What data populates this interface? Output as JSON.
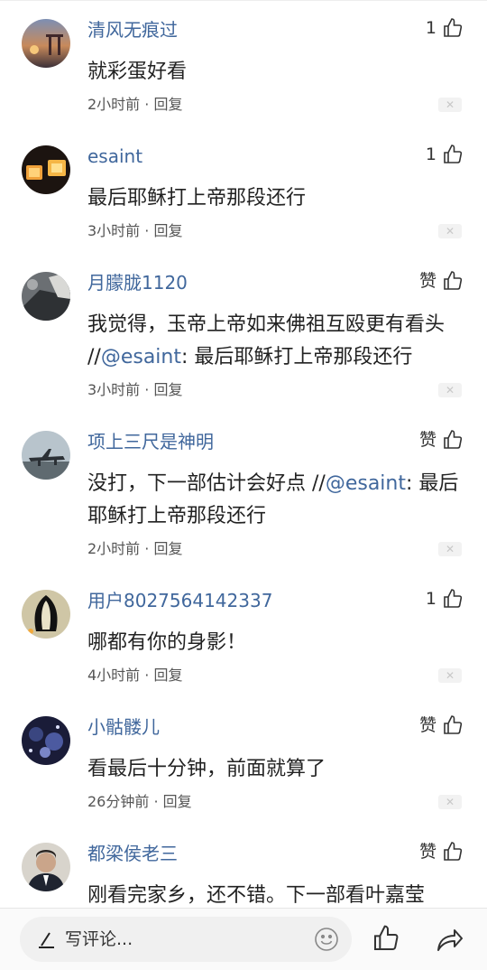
{
  "comments": [
    {
      "user": "清风无痕过",
      "likes": "1",
      "text": "就彩蛋好看",
      "mention": "",
      "after": "",
      "time": "2小时前",
      "reply": "回复",
      "avatar": "sunset-avatar"
    },
    {
      "user": "esaint",
      "likes": "1",
      "text": "最后耶稣打上帝那段还行",
      "mention": "",
      "after": "",
      "time": "3小时前",
      "reply": "回复",
      "avatar": "lantern-avatar"
    },
    {
      "user": "月朦胧1120",
      "likes": "赞",
      "text": "我觉得，玉帝上帝如来佛祖互殴更有看头 //",
      "mention": "@esaint",
      "after": ": 最后耶稣打上帝那段还行",
      "time": "3小时前",
      "reply": "回复",
      "avatar": "car-avatar"
    },
    {
      "user": "项上三尺是神明",
      "likes": "赞",
      "text": "没打，下一部估计会好点 //",
      "mention": "@esaint",
      "after": ": 最后耶稣打上帝那段还行",
      "time": "2小时前",
      "reply": "回复",
      "avatar": "airplane-avatar"
    },
    {
      "user": "用户8027564142337",
      "likes": "1",
      "text": "哪都有你的身影！",
      "mention": "",
      "after": "",
      "time": "4小时前",
      "reply": "回复",
      "avatar": "penguin-avatar"
    },
    {
      "user": "小骷髅儿",
      "likes": "赞",
      "text": "看最后十分钟，前面就算了",
      "mention": "",
      "after": "",
      "time": "26分钟前",
      "reply": "回复",
      "avatar": "night-avatar"
    },
    {
      "user": "都梁侯老三",
      "likes": "赞",
      "text": "刚看完家乡，还不错。下一部看叶嘉莹",
      "mention": "",
      "after": "",
      "time": "",
      "reply": "",
      "avatar": "man-avatar"
    }
  ],
  "meta_separator": "·",
  "close_glyph": "✕",
  "bottom_bar": {
    "placeholder": "写评论...",
    "icons": [
      "pen-icon",
      "emoji-icon",
      "like-icon",
      "share-icon"
    ]
  },
  "colors": {
    "username": "#40679c",
    "mention": "#40679c",
    "text": "#222222"
  }
}
